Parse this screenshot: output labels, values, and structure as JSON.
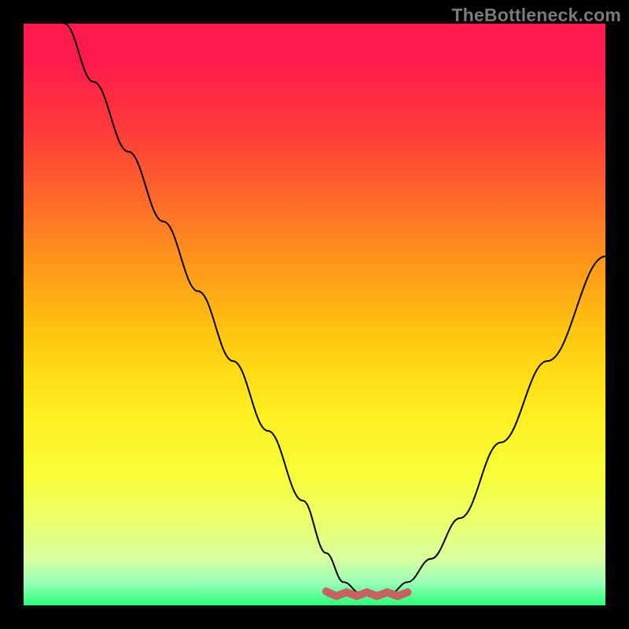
{
  "watermark": "TheBottleneck.com",
  "chart_data": {
    "type": "line",
    "title": "",
    "xlabel": "",
    "ylabel": "",
    "xlim": [
      0,
      1
    ],
    "ylim": [
      0,
      1
    ],
    "legend": false,
    "grid": false,
    "background": "rainbow-gradient",
    "series": [
      {
        "name": "bottleneck-curve",
        "color": "#000000",
        "x": [
          0.07,
          0.12,
          0.18,
          0.24,
          0.3,
          0.36,
          0.42,
          0.48,
          0.52,
          0.55,
          0.58,
          0.63,
          0.66,
          0.7,
          0.75,
          0.82,
          0.9,
          1.0
        ],
        "y": [
          1.0,
          0.9,
          0.78,
          0.66,
          0.54,
          0.42,
          0.3,
          0.18,
          0.09,
          0.04,
          0.02,
          0.02,
          0.04,
          0.08,
          0.15,
          0.28,
          0.42,
          0.6
        ]
      }
    ],
    "annotations": [
      {
        "name": "optimal-region",
        "type": "range-marker",
        "color": "#c66262",
        "x_range": [
          0.52,
          0.66
        ],
        "y": 0.02
      }
    ]
  }
}
